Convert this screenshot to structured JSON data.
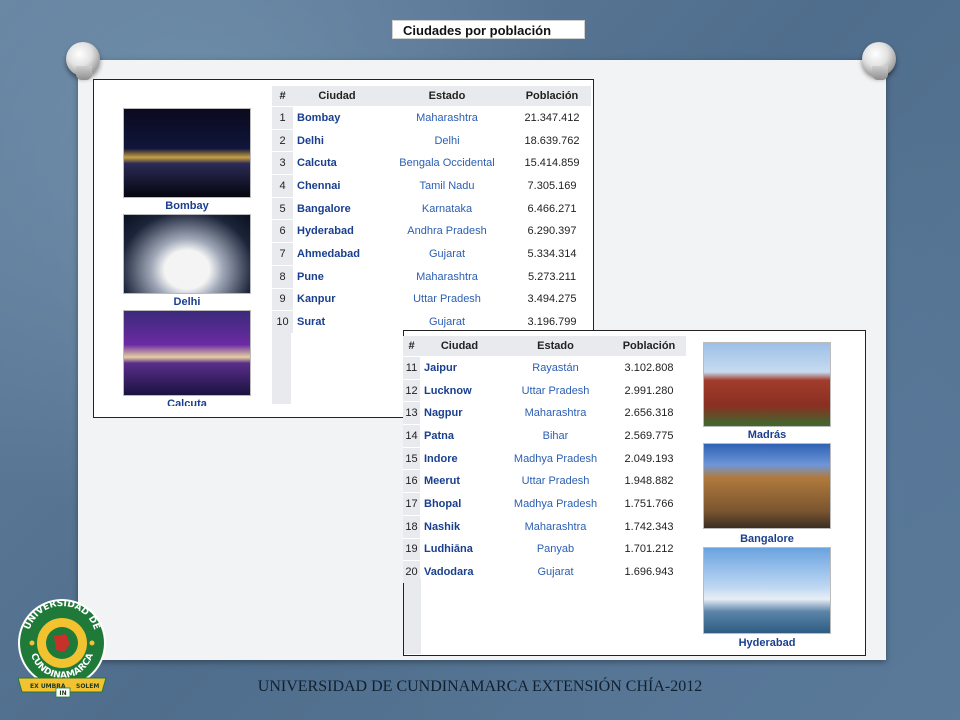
{
  "slide": {
    "title": "Ciudades por población",
    "footer": "UNIVERSIDAD DE CUNDINAMARCA EXTENSIÓN CHÍA-2012"
  },
  "table1": {
    "headers": [
      "#",
      "Ciudad",
      "Estado",
      "Población"
    ],
    "rows": [
      {
        "n": "1",
        "city": "Bombay",
        "state": "Maharashtra",
        "pop": "21.347.412"
      },
      {
        "n": "2",
        "city": "Delhi",
        "state": "Delhi",
        "pop": "18.639.762"
      },
      {
        "n": "3",
        "city": "Calcuta",
        "state": "Bengala Occidental",
        "pop": "15.414.859"
      },
      {
        "n": "4",
        "city": "Chennai",
        "state": "Tamil Nadu",
        "pop": "7.305.169"
      },
      {
        "n": "5",
        "city": "Bangalore",
        "state": "Karnataka",
        "pop": "6.466.271"
      },
      {
        "n": "6",
        "city": "Hyderabad",
        "state": "Andhra Pradesh",
        "pop": "6.290.397"
      },
      {
        "n": "7",
        "city": "Ahmedabad",
        "state": "Gujarat",
        "pop": "5.334.314"
      },
      {
        "n": "8",
        "city": "Pune",
        "state": "Maharashtra",
        "pop": "5.273.211"
      },
      {
        "n": "9",
        "city": "Kanpur",
        "state": "Uttar Pradesh",
        "pop": "3.494.275"
      },
      {
        "n": "10",
        "city": "Surat",
        "state": "Gujarat",
        "pop": "3.196.799"
      }
    ],
    "captions": [
      "Bombay",
      "Delhi",
      "Calcuta"
    ]
  },
  "table2": {
    "headers": [
      "#",
      "Ciudad",
      "Estado",
      "Población"
    ],
    "rows": [
      {
        "n": "11",
        "city": "Jaipur",
        "state": "Rayastán",
        "pop": "3.102.808"
      },
      {
        "n": "12",
        "city": "Lucknow",
        "state": "Uttar Pradesh",
        "pop": "2.991.280"
      },
      {
        "n": "13",
        "city": "Nagpur",
        "state": "Maharashtra",
        "pop": "2.656.318"
      },
      {
        "n": "14",
        "city": "Patna",
        "state": "Bihar",
        "pop": "2.569.775"
      },
      {
        "n": "15",
        "city": "Indore",
        "state": "Madhya Pradesh",
        "pop": "2.049.193"
      },
      {
        "n": "16",
        "city": "Meerut",
        "state": "Uttar Pradesh",
        "pop": "1.948.882"
      },
      {
        "n": "17",
        "city": "Bhopal",
        "state": "Madhya Pradesh",
        "pop": "1.751.766"
      },
      {
        "n": "18",
        "city": "Nashik",
        "state": "Maharashtra",
        "pop": "1.742.343"
      },
      {
        "n": "19",
        "city": "Ludhiāna",
        "state": "Panyab",
        "pop": "1.701.212"
      },
      {
        "n": "20",
        "city": "Vadodara",
        "state": "Gujarat",
        "pop": "1.696.943"
      }
    ],
    "captions": [
      "Madrás",
      "Bangalore",
      "Hyderabad"
    ]
  },
  "logo": {
    "ring_top": "UNIVERSIDAD DE",
    "ring_bottom": "CUNDINAMARCA",
    "motto_left": "EX UMBRA",
    "motto_mid": "IN",
    "motto_right": "SOLEM"
  },
  "colors": {
    "link_blue": "#1a3f8f",
    "state_blue": "#2b5fb3",
    "logo_green": "#1f7a3a",
    "logo_yellow": "#f2c230"
  }
}
